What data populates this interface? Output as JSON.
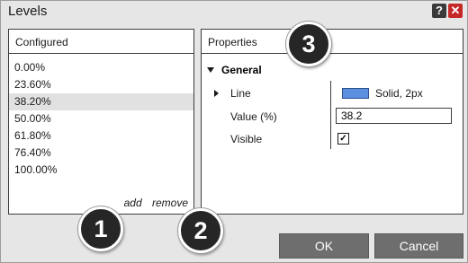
{
  "window": {
    "title": "Levels",
    "help_label": "?",
    "close_label": "✕"
  },
  "configured": {
    "header": "Configured",
    "levels": [
      "0.00%",
      "23.60%",
      "38.20%",
      "50.00%",
      "61.80%",
      "76.40%",
      "100.00%"
    ],
    "selected_index": 2,
    "add_label": "add",
    "remove_label": "remove"
  },
  "properties": {
    "header": "Properties",
    "group_label": "General",
    "line_label": "Line",
    "line_value": "Solid, 2px",
    "line_color": "#5b8fe0",
    "value_label": "Value (%)",
    "value": "38.2",
    "visible_label": "Visible",
    "visible_checked": true
  },
  "buttons": {
    "ok": "OK",
    "cancel": "Cancel"
  },
  "callouts": [
    "1",
    "2",
    "3"
  ],
  "colors": {
    "dialog_bg": "#e6e6e6",
    "button_bg": "#6e6e6e",
    "close_red": "#c62828",
    "selected_row": "#e1e1e1"
  }
}
